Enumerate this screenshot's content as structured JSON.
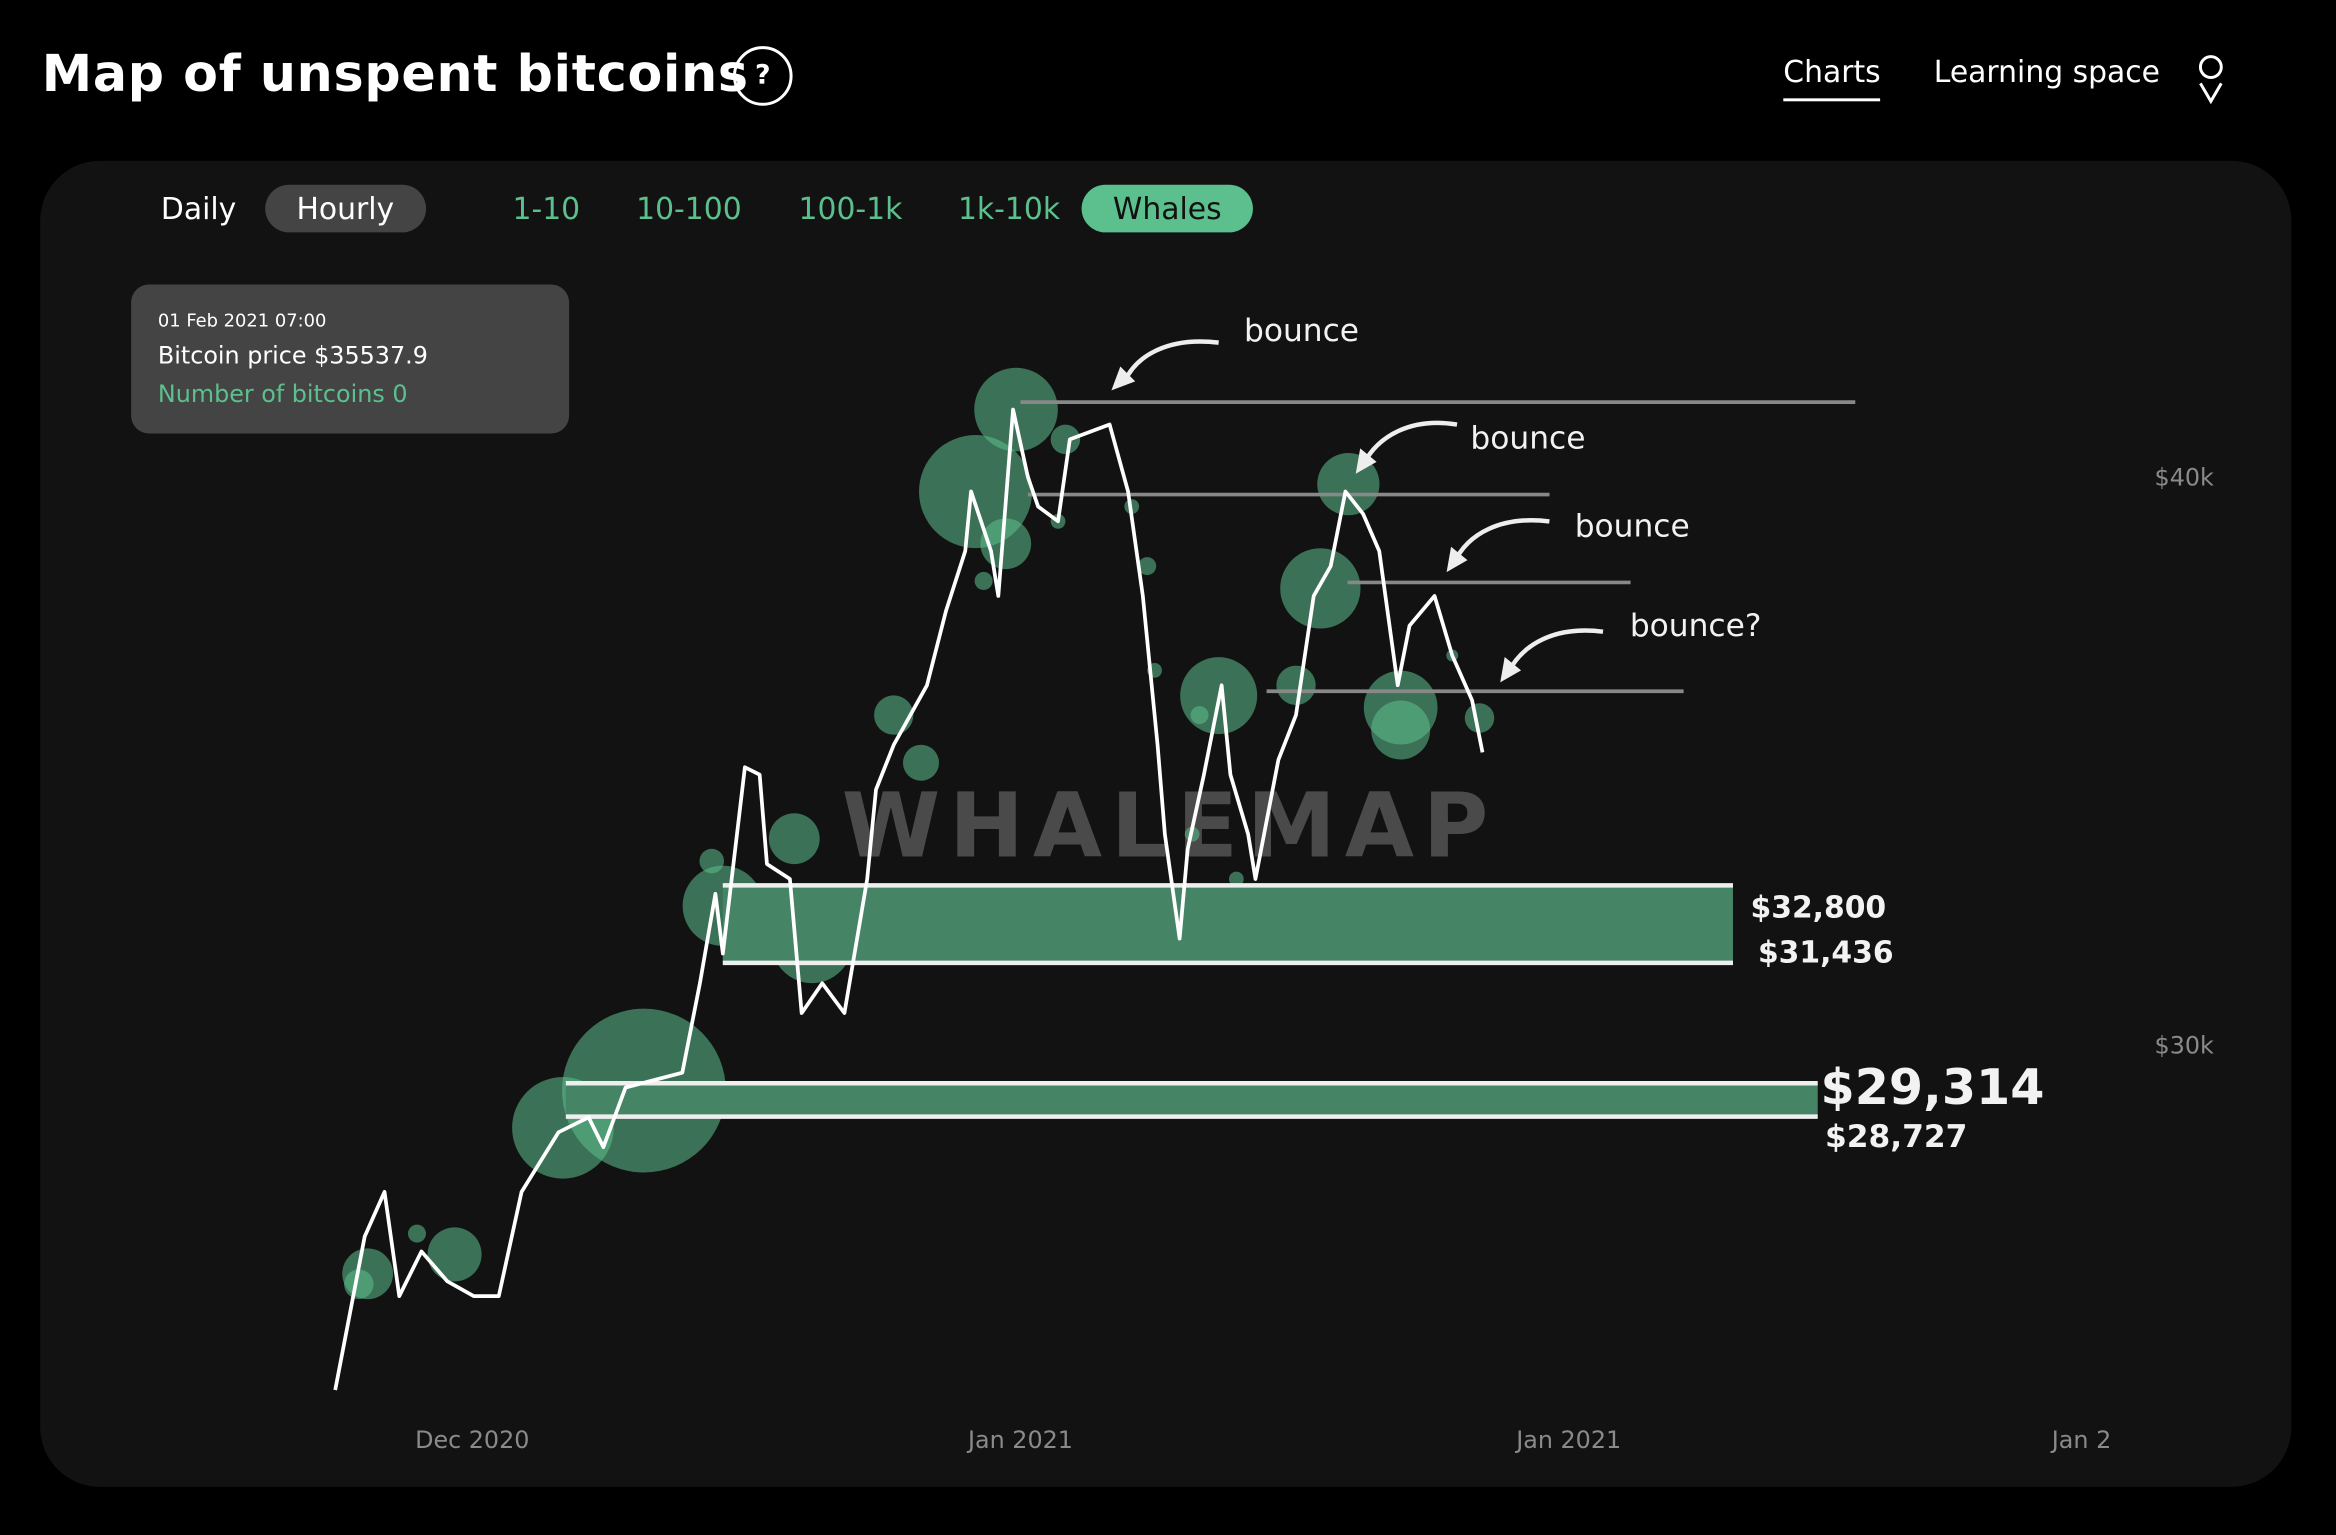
{
  "header": {
    "title": "Map of unspent bitcoins",
    "help_label": "?",
    "nav": {
      "charts": "Charts",
      "learning_space": "Learning space"
    },
    "icons": {
      "help": "question-circle-icon",
      "user": "map-pin-user-icon"
    }
  },
  "controls": {
    "timeframes": [
      {
        "label": "Daily",
        "active": false
      },
      {
        "label": "Hourly",
        "active": true
      }
    ],
    "ranges": [
      {
        "label": "1-10",
        "active": false
      },
      {
        "label": "10-100",
        "active": false
      },
      {
        "label": "100-1k",
        "active": false
      },
      {
        "label": "1k-10k",
        "active": false
      },
      {
        "label": "Whales",
        "active": true
      }
    ]
  },
  "tooltip": {
    "date": "01 Feb 2021 07:00",
    "price": "Bitcoin price $35537.9",
    "bitcoins": "Number of bitcoins 0"
  },
  "colors": {
    "background": "#000000",
    "panel": "#121212",
    "accent": "#5cc08e",
    "band": "#468466",
    "line": "#ffffff"
  },
  "chart_data": {
    "type": "line",
    "watermark": "WHALEMAP",
    "x_ticks": [
      {
        "label": "Dec 2020",
        "date": "2020-12-01"
      },
      {
        "label": "Jan 2021",
        "date": "2021-01-01"
      },
      {
        "label": "Jan 2021",
        "date": "2021-02-01"
      },
      {
        "label": "Jan 2",
        "date": "2021-03-02"
      }
    ],
    "y_ticks": [
      {
        "label": "$40k",
        "value": 40000
      },
      {
        "label": "$30k",
        "value": 30000
      }
    ],
    "y_axis_position": "right",
    "grid": false,
    "price_series": [
      [
        "2020-11-23T06:00",
        23910
      ],
      [
        "2020-11-24T22:00",
        26614
      ],
      [
        "2020-11-26T01:00",
        27401
      ],
      [
        "2020-11-26T21:00",
        25564
      ],
      [
        "2020-11-28T03:00",
        26351
      ],
      [
        "2020-11-29T14:00",
        25826
      ],
      [
        "2020-12-01T02:00",
        25564
      ],
      [
        "2020-12-02T12:00",
        25564
      ],
      [
        "2020-12-03T19:00",
        27401
      ],
      [
        "2020-12-05T21:00",
        28451
      ],
      [
        "2020-12-07T14:00",
        28714
      ],
      [
        "2020-12-08T10:00",
        28189
      ],
      [
        "2020-12-09T16:00",
        29239
      ],
      [
        "2020-12-12T21:00",
        29501
      ],
      [
        "2020-12-13T21:00",
        31076
      ],
      [
        "2020-12-14T18:00",
        32651
      ],
      [
        "2020-12-15T04:00",
        31601
      ],
      [
        "2020-12-16T10:00",
        34883
      ],
      [
        "2020-12-17T06:00",
        34751
      ],
      [
        "2020-12-17T16:00",
        33176
      ],
      [
        "2020-12-18T23:00",
        32914
      ],
      [
        "2020-12-19T15:00",
        30551
      ],
      [
        "2020-12-20T19:00",
        31076
      ],
      [
        "2020-12-22T01:00",
        30551
      ],
      [
        "2020-12-23T08:00",
        32914
      ],
      [
        "2020-12-23T20:00",
        34489
      ],
      [
        "2020-12-24T20:00",
        35276
      ],
      [
        "2020-12-26T17:00",
        36326
      ],
      [
        "2020-12-27T19:00",
        37639
      ],
      [
        "2020-12-28T21:00",
        38689
      ],
      [
        "2020-12-29T05:00",
        39739
      ],
      [
        "2020-12-30T08:00",
        38689
      ],
      [
        "2020-12-30T18:00",
        37901
      ],
      [
        "2020-12-31T14:00",
        41183
      ],
      [
        "2021-01-01T10:00",
        40001
      ],
      [
        "2021-01-02T00:00",
        39476
      ],
      [
        "2021-01-03T03:00",
        39214
      ],
      [
        "2021-01-03T19:00",
        40658
      ],
      [
        "2021-01-06T01:00",
        40920
      ],
      [
        "2021-01-07T02:00",
        39739
      ],
      [
        "2021-01-07T22:00",
        37901
      ],
      [
        "2021-01-08T18:00",
        35276
      ],
      [
        "2021-01-09T04:00",
        33701
      ],
      [
        "2021-01-10T00:00",
        31864
      ],
      [
        "2021-01-10T11:00",
        33439
      ],
      [
        "2021-01-11T09:00",
        34751
      ],
      [
        "2021-01-12T09:00",
        36326
      ],
      [
        "2021-01-12T21:00",
        34751
      ],
      [
        "2021-01-13T21:00",
        33701
      ],
      [
        "2021-01-14T07:00",
        32914
      ],
      [
        "2021-01-15T14:00",
        35014
      ],
      [
        "2021-01-16T14:00",
        35801
      ],
      [
        "2021-01-17T14:00",
        37901
      ],
      [
        "2021-01-18T13:00",
        38426
      ],
      [
        "2021-01-19T09:00",
        39739
      ],
      [
        "2021-01-20T09:00",
        39345
      ],
      [
        "2021-01-21T07:00",
        38689
      ],
      [
        "2021-01-22T08:00",
        36326
      ],
      [
        "2021-01-23T00:00",
        37376
      ],
      [
        "2021-01-24T10:00",
        37901
      ],
      [
        "2021-01-25T10:00",
        36851
      ],
      [
        "2021-01-26T13:00",
        36064
      ],
      [
        "2021-01-27T03:00",
        35145
      ]
    ],
    "whale_bubbles": [
      [
        "2020-11-25T02:00",
        25958,
        0.31
      ],
      [
        "2020-11-24T14:00",
        25774,
        0.18
      ],
      [
        "2020-11-30T00:00",
        26299,
        0.33
      ],
      [
        "2020-11-27T21:00",
        26666,
        0.11
      ],
      [
        "2020-12-06T03:00",
        28530,
        0.62
      ],
      [
        "2020-12-10T17:00",
        29186,
        1.0
      ],
      [
        "2020-12-15T04:00",
        32441,
        0.49
      ],
      [
        "2020-12-14T13:00",
        33229,
        0.15
      ],
      [
        "2020-12-19T05:00",
        33623,
        0.31
      ],
      [
        "2020-12-20T05:00",
        31785,
        0.49
      ],
      [
        "2020-12-24T20:00",
        35801,
        0.24
      ],
      [
        "2020-12-26T09:00",
        34961,
        0.22
      ],
      [
        "2020-12-29T11:00",
        39739,
        0.69
      ],
      [
        "2020-12-31T18:00",
        41183,
        0.51
      ],
      [
        "2020-12-31T04:00",
        38820,
        0.31
      ],
      [
        "2020-12-29T22:00",
        38164,
        0.11
      ],
      [
        "2021-01-03T13:00",
        40658,
        0.18
      ],
      [
        "2021-01-03T03:00",
        39214,
        0.09
      ],
      [
        "2021-01-07T07:00",
        39476,
        0.09
      ],
      [
        "2021-01-08T04:00",
        38426,
        0.11
      ],
      [
        "2021-01-08T14:00",
        36589,
        0.09
      ],
      [
        "2021-01-11T03:00",
        35801,
        0.11
      ],
      [
        "2021-01-12T05:00",
        36143,
        0.47
      ],
      [
        "2021-01-10T17:00",
        33701,
        0.09
      ],
      [
        "2021-01-16T14:00",
        36326,
        0.24
      ],
      [
        "2021-01-17T23:00",
        38033,
        0.49
      ],
      [
        "2021-01-19T13:00",
        39870,
        0.38
      ],
      [
        "2021-01-22T12:00",
        35933,
        0.45
      ],
      [
        "2021-01-22T12:00",
        35539,
        0.36
      ],
      [
        "2021-01-26T23:00",
        35749,
        0.18
      ],
      [
        "2021-01-25T10:00",
        36851,
        0.07
      ],
      [
        "2021-01-13T05:00",
        32914,
        0.09
      ]
    ],
    "resistance_lines": [
      {
        "price": 41314,
        "start": "2021-01-01T00:00",
        "end": "2021-02-17T05:00"
      },
      {
        "price": 39686,
        "start": "2021-01-01T10:00",
        "end": "2021-01-30T22:00"
      },
      {
        "price": 38138,
        "start": "2021-01-19T12:00",
        "end": "2021-02-04T12:00"
      },
      {
        "price": 36221,
        "start": "2021-01-14T22:00",
        "end": "2021-02-07T12:00"
      }
    ],
    "support_bands": [
      {
        "high": 32800,
        "low": 31436,
        "high_label": "$32,800",
        "low_label": "$31,436",
        "start": "2020-12-15T04:00",
        "end": "2021-02-10T07:00"
      },
      {
        "high": 29314,
        "low": 28727,
        "high_label": "$29,314",
        "low_label": "$28,727",
        "start": "2020-12-06T07:00",
        "end": "2021-02-15T02:00"
      }
    ],
    "annotations": [
      "bounce",
      "bounce",
      "bounce",
      "bounce?"
    ]
  }
}
